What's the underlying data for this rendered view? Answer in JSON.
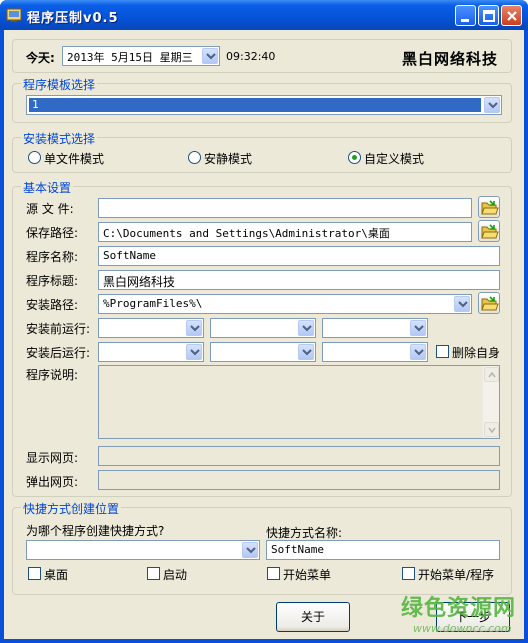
{
  "window": {
    "title": "程序压制v0.5"
  },
  "header": {
    "today_label": "今天:",
    "date_value": "2013年 5月15日 星期三",
    "time_value": "09:32:40",
    "brand": "黑白网络科技"
  },
  "template_group": {
    "legend": "程序模板选择",
    "selected": "1"
  },
  "mode_group": {
    "legend": "安装模式选择",
    "options": [
      "单文件模式",
      "安静模式",
      "自定义模式"
    ],
    "selected_index": 2
  },
  "basic_group": {
    "legend": "基本设置",
    "source_label": "源 文 件:",
    "source_value": "",
    "save_label": "保存路径:",
    "save_value": "C:\\Documents and Settings\\Administrator\\桌面",
    "name_label": "程序名称:",
    "name_value": "SoftName",
    "title_label": "程序标题:",
    "title_value": "黑白网络科技",
    "install_label": "安装路径:",
    "install_value": "%ProgramFiles%\\",
    "pre_run_label": "安装前运行:",
    "post_run_label": "安装后运行:",
    "delete_self_label": "删除自身",
    "desc_label": "程序说明:",
    "show_page_label": "显示网页:",
    "popup_page_label": "弹出网页:"
  },
  "shortcut_group": {
    "legend": "快捷方式创建位置",
    "which_label": "为哪个程序创建快捷方式?",
    "which_value": "",
    "name_label": "快捷方式名称:",
    "name_value": "SoftName",
    "checks": [
      "桌面",
      "启动",
      "开始菜单",
      "开始菜单/程序"
    ]
  },
  "footer": {
    "about_label": "关于",
    "next_label": "下一步"
  },
  "watermark": {
    "text": "绿色资源网",
    "url": "www.downcc.com"
  }
}
